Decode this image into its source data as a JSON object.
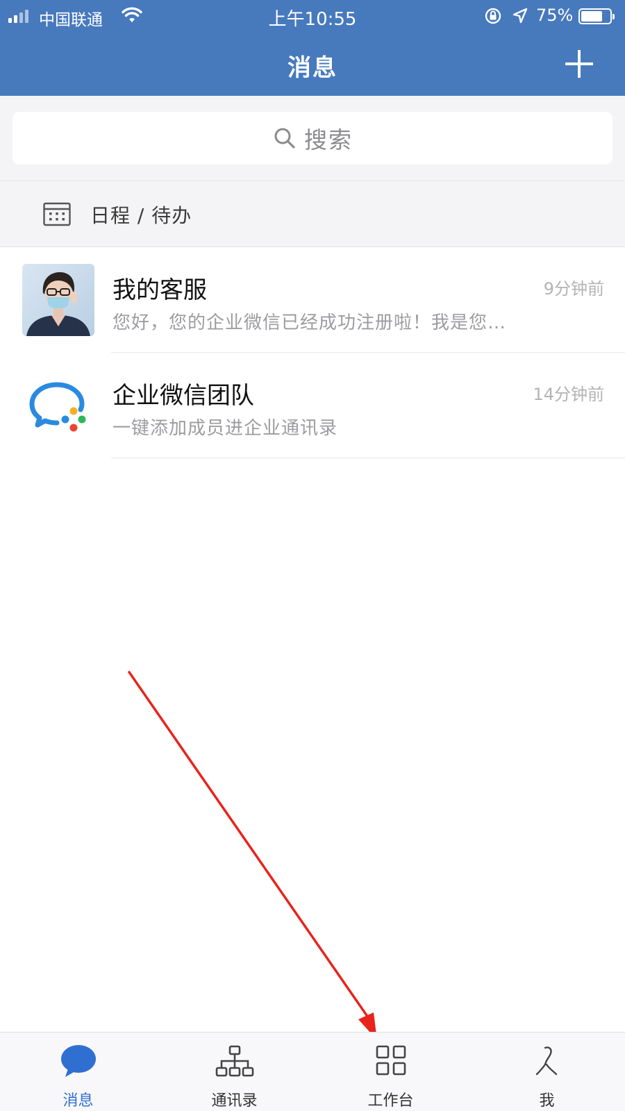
{
  "status_bar": {
    "carrier": "中国联通",
    "time": "上午10:55",
    "battery": "75%",
    "battery_level": 0.75
  },
  "nav": {
    "title": "消息",
    "add_icon": "plus-icon"
  },
  "search": {
    "placeholder": "搜索",
    "icon": "search-icon"
  },
  "schedule": {
    "label": "日程 / 待办",
    "icon": "calendar-icon"
  },
  "messages": [
    {
      "name": "我的客服",
      "time": "9分钟前",
      "preview": "您好，您的企业微信已经成功注册啦！我是您…",
      "avatar": "person-photo-avatar"
    },
    {
      "name": "企业微信团队",
      "time": "14分钟前",
      "preview": "一键添加成员进企业通讯录",
      "avatar": "wecom-logo-avatar"
    }
  ],
  "tabs": [
    {
      "label": "消息",
      "icon": "chat-bubble-icon",
      "active": true
    },
    {
      "label": "通讯录",
      "icon": "org-chart-icon",
      "active": false
    },
    {
      "label": "工作台",
      "icon": "grid-icon",
      "active": false
    },
    {
      "label": "我",
      "icon": "profile-icon",
      "active": false
    }
  ],
  "colors": {
    "header": "#4779bd",
    "accent": "#2f6fd0",
    "annotation_arrow": "#e8231b"
  }
}
